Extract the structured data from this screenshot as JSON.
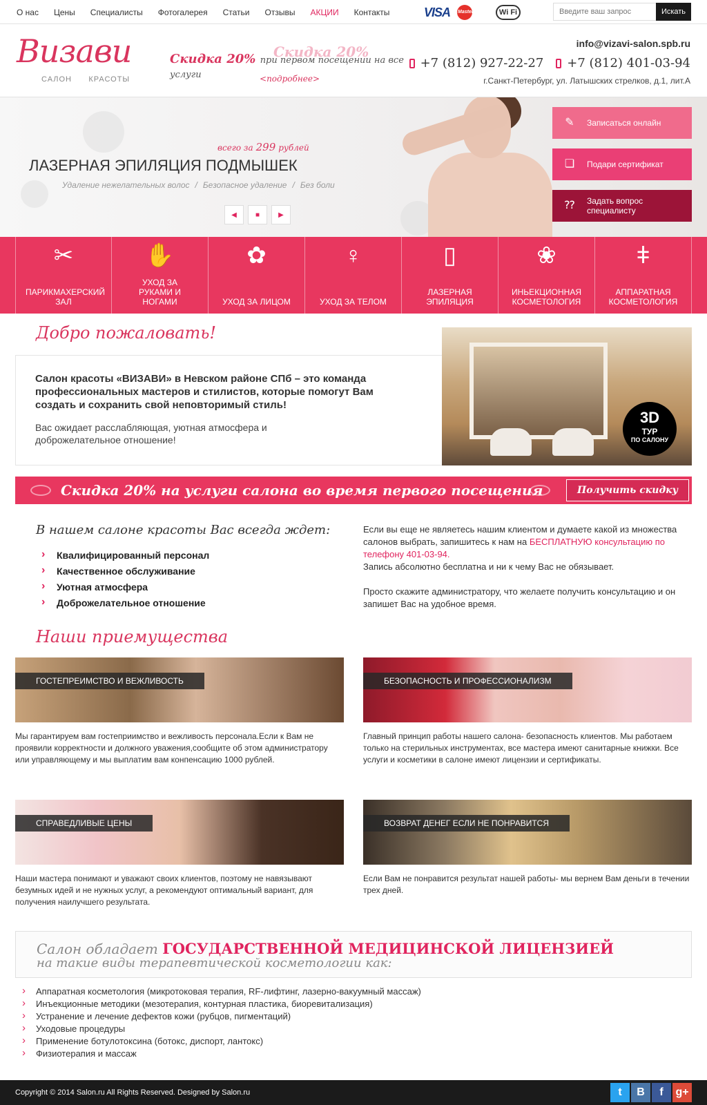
{
  "topnav": {
    "items": [
      "О нас",
      "Цены",
      "Специалисты",
      "Фотогалерея",
      "Статьи",
      "Отзывы",
      "АКЦИИ",
      "Контакты"
    ]
  },
  "payments": {
    "visa": "VISA",
    "mastercard": "MasterCard",
    "wifi": "Wi Fi"
  },
  "search": {
    "placeholder": "Введите ваш запрос",
    "button": "Искать"
  },
  "header": {
    "logo_script": "Визави",
    "logo_left": "САЛОН",
    "logo_right": "КРАСОТЫ",
    "promo_ghost": "Скидка 20%",
    "promo_prefix": "Скидка",
    "promo_percent": "20%",
    "promo_rest": "при первом посещении на все услуги",
    "promo_more": "подробнее",
    "email": "info@vizavi-salon.spb.ru",
    "phone1": "+7 (812) 927-22-27",
    "phone2": "+7 (812) 401-03-94",
    "address": "г.Санкт-Петербург, ул. Латышских стрелков,  д.1, лит.А"
  },
  "hero": {
    "price_prefix": "всего за",
    "price": "299",
    "price_suffix": "рублей",
    "title": "ЛАЗЕРНАЯ ЭПИЛЯЦИЯ ПОДМЫШЕК",
    "tags": [
      "Удаление нежелательных волос",
      "/",
      "Безопасное удаление",
      "/",
      "Без боли"
    ],
    "btn_online": "Записаться онлайн",
    "btn_gift": "Подари сертификат",
    "btn_ask": "Задать вопрос специалисту"
  },
  "services": [
    "ПАРИКМАХЕРСКИЙ ЗАЛ",
    "УХОД ЗА РУКАМИ И НОГАМИ",
    "УХОД ЗА ЛИЦОМ",
    "УХОД ЗА ТЕЛОМ",
    "ЛАЗЕРНАЯ ЭПИЛЯЦИЯ",
    "ИНЬЕКЦИОННАЯ КОСМЕТОЛОГИЯ",
    "АППАРАТНАЯ КОСМЕТОЛОГИЯ"
  ],
  "welcome": {
    "title": "Добро пожаловать!",
    "lead": "Салон красоты «ВИЗАВИ» в Невском районе СПб – это команда профессиональных мастеров и стилистов, которые помогут Вам создать и сохранить свой неповторимый стиль!",
    "text": "Вас ожидает расслабляющая, уютная атмосфера и доброжелательное отношение!",
    "badge_big": "3D",
    "badge_t1": "ТУР",
    "badge_t2": "ПО САЛОНУ"
  },
  "discount": {
    "text": "Скидка 20% на услуги салона во время первого посещения",
    "button": "Получить скидку"
  },
  "awaits": {
    "title": "В нашем салоне красоты Вас всегда ждет:",
    "items": [
      "Квалифицированный персонал",
      "Качественное обслуживание",
      "Уютная атмосфера",
      "Доброжелательное отношение"
    ]
  },
  "consult": {
    "p1_a": "Если вы еще не являетесь нашим клиентом и думаете какой из множества салонов выбрать, запишитесь к нам на ",
    "p1_link": "БЕСПЛАТНУЮ консультацию по телефону 401-03-94.",
    "p1_b": "Запись абсолютно бесплатна и ни к чему Вас не обязывает.",
    "p2": "Просто скажите администратору, что желаете получить консультацию и он запишет Вас на удобное время."
  },
  "advantages": {
    "title": "Наши приемущества",
    "items": [
      {
        "label": "ГОСТЕПРЕИМСТВО И ВЕЖЛИВОСТЬ",
        "text": "Мы гарантируем вам гостеприимство и вежливость персонала.Если к Вам не проявили корректности и должного уважения,сообщите об этом администратору или управляющему и мы выплатим вам конпенсацию 1000 рублей."
      },
      {
        "label": "БЕЗОПАСНОСТЬ И ПРОФЕССИОНАЛИЗМ",
        "text": "Главный принцип работы нашего салона- безопасность клиентов. Мы работаем только на стерильных инструментах, все мастера имеют санитарные книжки. Все услуги и косметики в салоне имеют лицензии и сертификаты."
      },
      {
        "label": "СПРАВЕДЛИВЫЕ ЦЕНЫ",
        "text": "Наши мастера понимают и уважают своих клиентов, поэтому не навязывают безумных идей и не нужных услуг, а рекомендуют оптимальный вариант, для получения наилучшего результата."
      },
      {
        "label": "ВОЗВРАТ ДЕНЕГ ЕСЛИ НЕ ПОНРАВИТСЯ",
        "text": "Если Вам не понравится результат нашей работы- мы вернем Вам деньги в течении трех дней."
      }
    ]
  },
  "license": {
    "l1_a": "Салон обладает",
    "l1_b": "ГОСУДАРСТВЕННОЙ МЕДИЦИНСКОЙ ЛИЦЕНЗИЕЙ",
    "l2": "на такие виды терапевтической косметологии как:",
    "items": [
      "Аппаратная косметология (микротоковая терапия, RF-лифтинг, лазерно-вакуумный массаж)",
      "Инъекционные методики (мезотерапия, контурная пластика, биоревитализация)",
      "Устранение и лечение дефектов кожи (рубцов, пигментаций)",
      "Уходовые процедуры",
      "Применение ботулотоксина (ботокс, диспорт, лантокс)",
      "Физиотерапия и массаж"
    ]
  },
  "footer": {
    "copyright": "Copyright © 2014 Salon.ru All Rights Reserved. Designed by Salon.ru",
    "social": [
      "t",
      "B",
      "f",
      "g+"
    ]
  },
  "colors": {
    "accent": "#e8375f",
    "dark": "#1b1b1b",
    "twitter": "#2aa3ef",
    "vk": "#4a76a8",
    "facebook": "#3b5998",
    "gplus": "#dd4b39"
  }
}
